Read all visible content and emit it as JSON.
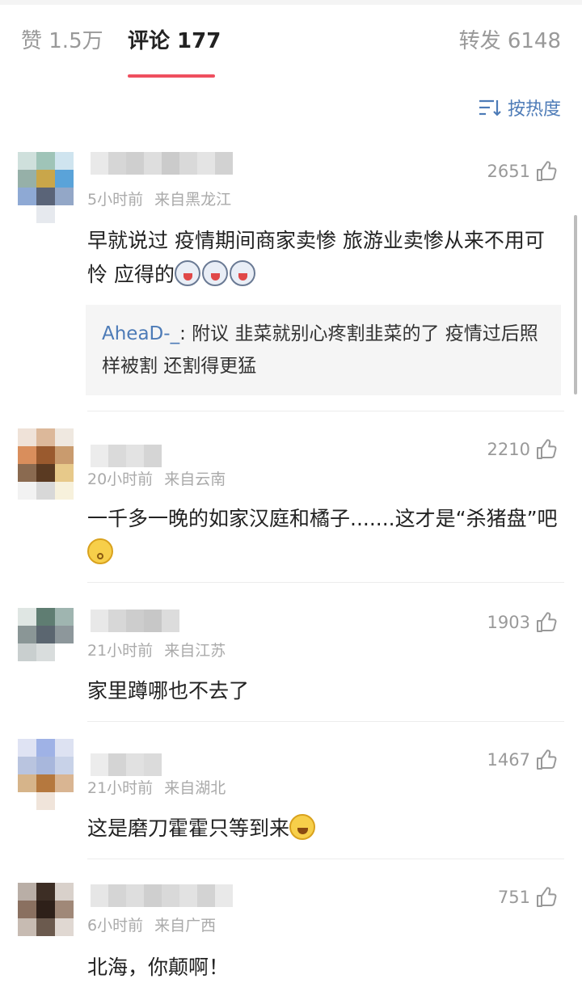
{
  "tabs": {
    "likes": "赞 1.5万",
    "comments": "评论 177",
    "reposts": "转发 6148"
  },
  "sort": {
    "label": "按热度",
    "icon": "sort-icon"
  },
  "comments": [
    {
      "time": "5小时前",
      "location": "来自黑龙江",
      "likes": "2651",
      "text": "早就说过 疫情期间商家卖惨 旅游业卖惨从来不用可怜 应得的",
      "emojis": [
        "laughing-dog-emoji",
        "laughing-dog-emoji",
        "laughing-dog-emoji"
      ],
      "reply": {
        "user": "AheaD-_",
        "text": ": 附议 韭菜就别心疼割韭菜的了 疫情过后照样被割 还割得更猛"
      }
    },
    {
      "time": "20小时前",
      "location": "来自云南",
      "likes": "2210",
      "text": "一千多一晚的如家汉庭和橘子.......这才是“杀猪盘”吧",
      "emojis": [
        "dizzy-face-emoji"
      ]
    },
    {
      "time": "21小时前",
      "location": "来自江苏",
      "likes": "1903",
      "text": "家里蹲哪也不去了"
    },
    {
      "time": "21小时前",
      "location": "来自湖北",
      "likes": "1467",
      "text": "这是磨刀霍霍只等到来",
      "emojis": [
        "crying-laughing-emoji"
      ]
    },
    {
      "time": "6小时前",
      "location": "来自广西",
      "likes": "751",
      "text": "北海，你颠啊！"
    }
  ],
  "colors": {
    "accent_underline": "#ef4f5f",
    "link_blue": "#4d7bb7"
  }
}
